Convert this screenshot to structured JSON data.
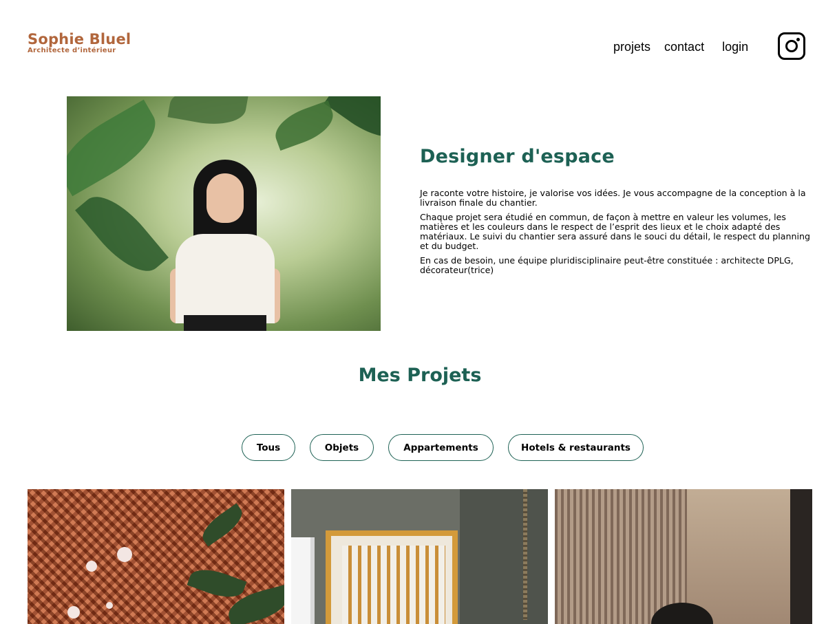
{
  "header": {
    "logo_title": "Sophie Bluel",
    "logo_subtitle": "Architecte d’intérieur",
    "nav": {
      "projets": "projets",
      "contact": "contact",
      "login": "login"
    },
    "instagram_icon": "instagram-icon"
  },
  "introduction": {
    "title": "Designer d'espace",
    "paragraphs": [
      "Je raconte votre histoire, je valorise vos idées. Je vous accompagne de la conception à la livraison finale du chantier.",
      "Chaque projet sera étudié en commun, de façon à mettre en valeur les volumes, les matières et les couleurs dans le respect de l’esprit des lieux et le choix adapté des matériaux. Le suivi du chantier sera assuré dans le souci du détail, le respect du planning et du budget.",
      "En cas de besoin, une équipe pluridisciplinaire peut-être constituée : architecte DPLG, décorateur(trice)"
    ]
  },
  "portfolio": {
    "title": "Mes Projets",
    "filters": [
      "Tous",
      "Objets",
      "Appartements",
      "Hotels & restaurants"
    ]
  },
  "colors": {
    "brand": "#B1663C",
    "accent": "#1D6154",
    "text": "#000000",
    "background": "#FFFFFF"
  }
}
